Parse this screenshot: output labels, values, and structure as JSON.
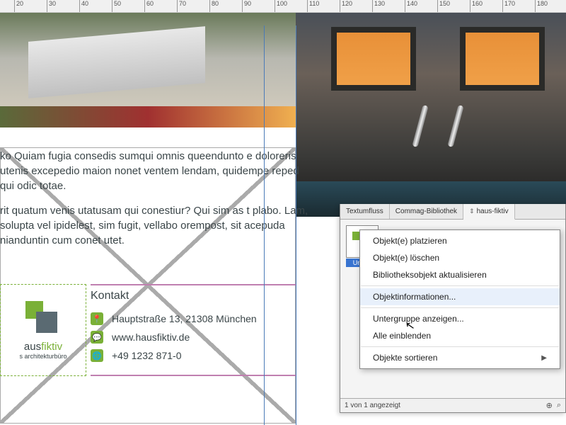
{
  "ruler_ticks": [
    "20",
    "30",
    "40",
    "50",
    "60",
    "70",
    "80",
    "90",
    "100",
    "110",
    "120",
    "130",
    "140",
    "150",
    "160",
    "170",
    "180"
  ],
  "body_paragraphs": [
    "ko Quiam fugia consedis sumqui omnis queendunto e doloreris utenis excepedio maion nonet ventem lendam, quidempe reped qui odic totae.",
    "rit quatum venis utatusam qui conestiur? Qui sim as t plabo. Lam, solupta vel ipidelest, sim fugit, vellabo orempost, sit acepuda nianduntin cum conet utet."
  ],
  "contact": {
    "heading": "Kontakt",
    "address": "Hauptstraße 13, 21308 München",
    "website": "www.hausfiktiv.de",
    "phone": "+49 1232 871-0"
  },
  "logo": {
    "name_part1": "aus",
    "name_part2": "fiktiv",
    "subtitle": "s architekturbüro"
  },
  "panel": {
    "tabs": [
      "Textumfluss",
      "Commag-Bibliothek",
      "haus-fiktiv"
    ],
    "thumb_label": "Unben",
    "status": "1 von 1 angezeigt"
  },
  "context_menu": {
    "items": [
      {
        "label": "Objekt(e) platzieren",
        "sep": false
      },
      {
        "label": "Objekt(e) löschen",
        "sep": false
      },
      {
        "label": "Bibliotheksobjekt aktualisieren",
        "sep": true
      },
      {
        "label": "Objektinformationen...",
        "sep": true,
        "highlight": true
      },
      {
        "label": "Untergruppe anzeigen...",
        "sep": false
      },
      {
        "label": "Alle einblenden",
        "sep": true
      },
      {
        "label": "Objekte sortieren",
        "sep": false,
        "submenu": true
      }
    ]
  }
}
